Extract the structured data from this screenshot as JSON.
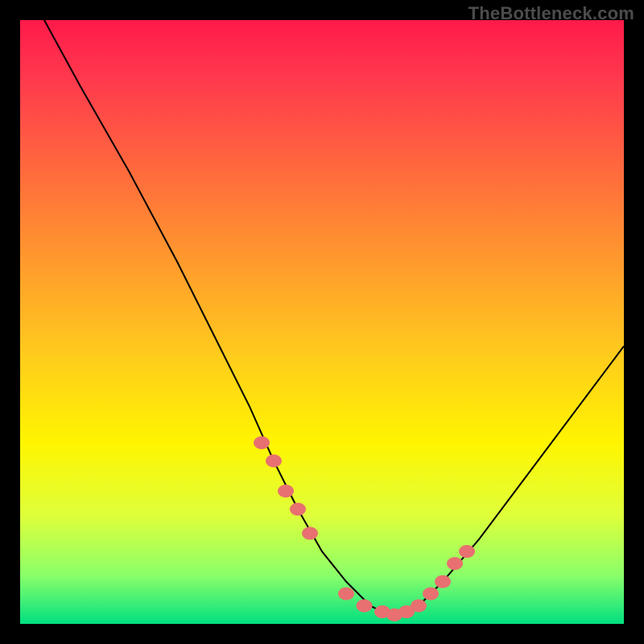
{
  "watermark": "TheBottleneck.com",
  "chart_data": {
    "type": "line",
    "title": "",
    "xlabel": "",
    "ylabel": "",
    "xlim": [
      0,
      100
    ],
    "ylim": [
      0,
      100
    ],
    "curve": {
      "x": [
        4,
        10,
        18,
        26,
        32,
        38,
        42,
        46,
        50,
        54,
        58,
        60,
        62,
        64,
        66,
        70,
        76,
        82,
        88,
        94,
        100
      ],
      "y": [
        100,
        89,
        75,
        60,
        48,
        36,
        27,
        19,
        12,
        7,
        3,
        2,
        1.5,
        2,
        3,
        7,
        14,
        22,
        30,
        38,
        46
      ]
    },
    "series": [
      {
        "name": "highlighted-points",
        "marker_color": "#e87070",
        "x": [
          40,
          42,
          44,
          46,
          48,
          54,
          57,
          60,
          62,
          64,
          66,
          68,
          70,
          72,
          74
        ],
        "y": [
          30,
          27,
          22,
          19,
          15,
          5,
          3,
          2,
          1.5,
          2,
          3,
          5,
          7,
          10,
          12
        ]
      }
    ]
  }
}
